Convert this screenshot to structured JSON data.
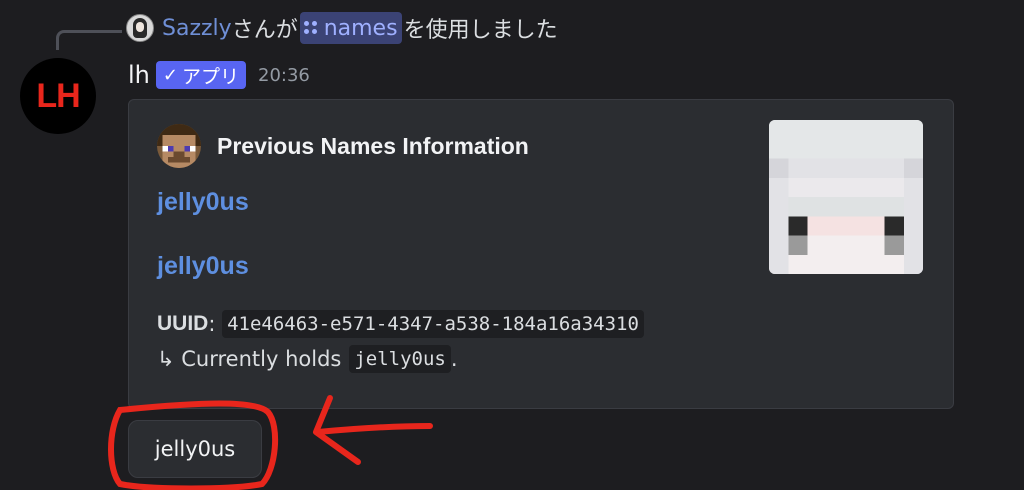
{
  "reply": {
    "user": "Sazzly",
    "prefix_text": "さんが",
    "command": "names",
    "suffix_text": "を使用しました"
  },
  "message": {
    "avatar_text": "LH",
    "author": "lh",
    "badge": "アプリ",
    "timestamp": "20:36"
  },
  "embed": {
    "author_name": "Previous Names Information",
    "fields": [
      {
        "title": "jelly0us"
      },
      {
        "title": "jelly0us"
      }
    ],
    "uuid_label": "UUID",
    "uuid_value": "41e46463-e571-4347-a538-184a16a34310",
    "holds_prefix": "↳ Currently holds",
    "holds_value": "jelly0us",
    "holds_suffix": "."
  },
  "button": {
    "label": "jelly0us"
  },
  "colors": {
    "annotation": "#e8261c",
    "accent": "#5865f2",
    "link": "#5e8fe0"
  }
}
